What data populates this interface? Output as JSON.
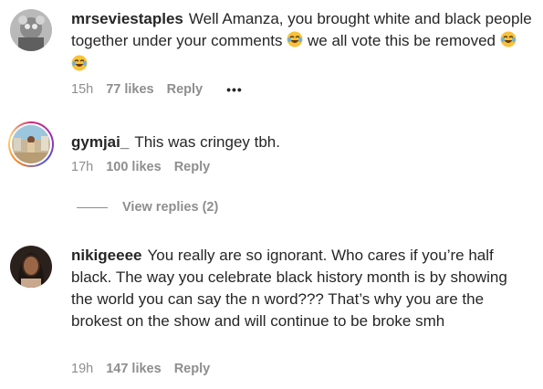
{
  "comments": [
    {
      "username": "mrseviestaples",
      "text_before": "Well Amanza, you brought white and black people together under your comments",
      "text_middle": "we all vote this be removed",
      "emojis_inline": "face-with-tears-of-joy",
      "emojis_end": [
        "face-with-tears-of-joy",
        "face-with-tears-of-joy"
      ],
      "time": "15h",
      "likes": "77 likes",
      "reply": "Reply",
      "more": "•••",
      "avatar": "avatar-icon"
    },
    {
      "username": "gymjai_",
      "text": "This was cringey tbh.",
      "time": "17h",
      "likes": "100 likes",
      "reply": "Reply",
      "avatar": "avatar-icon",
      "story_ring": true
    },
    {
      "username": "nikigeeee",
      "text": "You really are so ignorant. Who cares if you’re half black. The way you celebrate black history month is by showing the world you can say the n word??? That’s why you are the brokest on the show and will continue to be broke smh",
      "time": "19h",
      "likes": "147 likes",
      "reply": "Reply",
      "avatar": "avatar-icon"
    }
  ],
  "view_replies": "View replies (2)",
  "colors": {
    "text": "#262626",
    "secondary": "#8e8e8e",
    "background": "#ffffff"
  }
}
